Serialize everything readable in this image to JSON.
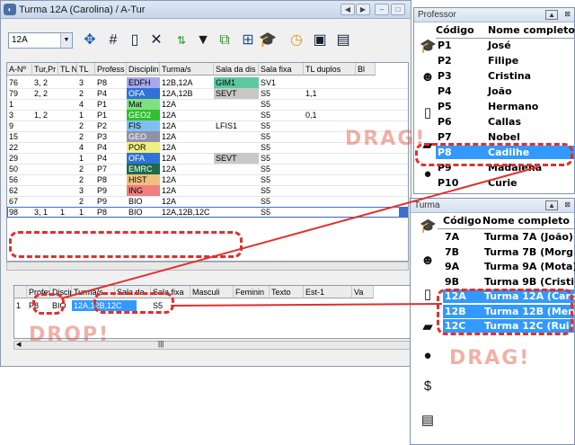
{
  "window": {
    "title": "Turma 12A (Carolina) / A-Tur"
  },
  "toolbar": {
    "class_select": "12A"
  },
  "table": {
    "headers": [
      "A-Nº",
      "Tur,Pr",
      "TL Ni",
      "TL",
      "Profess",
      "Disciplina",
      "Turma/s",
      "Sala da dis",
      "Sala fixa",
      "TL duplos",
      "Bl"
    ],
    "rows": [
      {
        "n": "76",
        "tp": "3, 2",
        "tln": "",
        "tl": "3",
        "prof": "P8",
        "disc": "EDFH",
        "disc_color": "#a8a8f0",
        "turmas": "12B,12A",
        "sala": "GIM1",
        "sala_color": "#5ec8a0",
        "fixa": "SV1",
        "dup": ""
      },
      {
        "n": "79",
        "tp": "2, 2",
        "tln": "",
        "tl": "2",
        "prof": "P4",
        "disc": "OFA",
        "disc_color": "#2f72d8",
        "turmas": "12A,12B",
        "sala": "SEVT",
        "sala_color": "#c8c8c8",
        "fixa": "S5",
        "dup": "1,1"
      },
      {
        "n": "1",
        "tp": "",
        "tln": "",
        "tl": "4",
        "prof": "P1",
        "disc": "Mat",
        "disc_color": "#80e080",
        "turmas": "12A",
        "sala": "",
        "sala_color": "",
        "fixa": "S5",
        "dup": ""
      },
      {
        "n": "3",
        "tp": "1, 2",
        "tln": "",
        "tl": "1",
        "prof": "P1",
        "disc": "GEO2",
        "disc_color": "#30c030",
        "turmas": "12A",
        "sala": "",
        "sala_color": "",
        "fixa": "S5",
        "dup": "0,1"
      },
      {
        "n": "9",
        "tp": "",
        "tln": "",
        "tl": "2",
        "prof": "P2",
        "disc": "FIS",
        "disc_color": "#80c0f0",
        "turmas": "12A",
        "sala": "LFIS1",
        "sala_color": "",
        "fixa": "S5",
        "dup": ""
      },
      {
        "n": "15",
        "tp": "",
        "tln": "",
        "tl": "2",
        "prof": "P3",
        "disc": "GEO",
        "disc_color": "#9090a8",
        "turmas": "12A",
        "sala": "",
        "sala_color": "",
        "fixa": "S5",
        "dup": ""
      },
      {
        "n": "22",
        "tp": "",
        "tln": "",
        "tl": "4",
        "prof": "P4",
        "disc": "POR",
        "disc_color": "#f0f080",
        "turmas": "12A",
        "sala": "",
        "sala_color": "",
        "fixa": "S5",
        "dup": ""
      },
      {
        "n": "29",
        "tp": "",
        "tln": "",
        "tl": "1",
        "prof": "P4",
        "disc": "OFA",
        "disc_color": "#2f72d8",
        "turmas": "12A",
        "sala": "SEVT",
        "sala_color": "#c8c8c8",
        "fixa": "S5",
        "dup": ""
      },
      {
        "n": "50",
        "tp": "",
        "tln": "",
        "tl": "2",
        "prof": "P7",
        "disc": "EMRC",
        "disc_color": "#1e6a4a",
        "turmas": "12A",
        "sala": "",
        "sala_color": "",
        "fixa": "S5",
        "dup": ""
      },
      {
        "n": "56",
        "tp": "",
        "tln": "",
        "tl": "2",
        "prof": "P8",
        "disc": "HIST",
        "disc_color": "#f0c080",
        "turmas": "12A",
        "sala": "",
        "sala_color": "",
        "fixa": "S5",
        "dup": ""
      },
      {
        "n": "62",
        "tp": "",
        "tln": "",
        "tl": "3",
        "prof": "P9",
        "disc": "ING",
        "disc_color": "#f08080",
        "turmas": "12A",
        "sala": "",
        "sala_color": "",
        "fixa": "S5",
        "dup": ""
      },
      {
        "n": "67",
        "tp": "",
        "tln": "",
        "tl": "2",
        "prof": "P9",
        "disc": "BIO",
        "disc_color": "",
        "turmas": "12A",
        "sala": "",
        "sala_color": "",
        "fixa": "S5",
        "dup": ""
      },
      {
        "n": "98",
        "tp": "3, 1",
        "tln": "1",
        "tl": "1",
        "prof": "P8",
        "disc": "BIO",
        "disc_color": "",
        "turmas": "12A,12B,12C",
        "sala": "",
        "sala_color": "",
        "fixa": "S5",
        "dup": ""
      }
    ]
  },
  "detail": {
    "headers": [
      "",
      "Profess",
      "Discip",
      "Turma/s",
      "Sala da",
      "Sala fixa",
      "Masculi",
      "Feminin",
      "Texto",
      "Est-1",
      "Va"
    ],
    "row": {
      "n": "1",
      "prof": "P8",
      "disc": "BIO",
      "turmas": "12A,12B,12C",
      "fixa": "S5"
    }
  },
  "professor_panel": {
    "title": "Professor",
    "col_code": "Código",
    "col_name": "Nome completo",
    "items": [
      {
        "code": "P1",
        "name": "José"
      },
      {
        "code": "P2",
        "name": "Filipe"
      },
      {
        "code": "P3",
        "name": "Cristina"
      },
      {
        "code": "P4",
        "name": "João"
      },
      {
        "code": "P5",
        "name": "Hermano"
      },
      {
        "code": "P6",
        "name": "Callas"
      },
      {
        "code": "P7",
        "name": "Nobel"
      },
      {
        "code": "P8",
        "name": "Cadilhe"
      },
      {
        "code": "P9",
        "name": "Madalena"
      },
      {
        "code": "P10",
        "name": "Curie"
      }
    ]
  },
  "turma_panel": {
    "title": "Turma",
    "col_code": "Código",
    "col_name": "Nome completo",
    "items": [
      {
        "code": "7A",
        "name": "Turma 7A (João)"
      },
      {
        "code": "7B",
        "name": "Turma 7B (Morg"
      },
      {
        "code": "9A",
        "name": "Turma 9A (Mota)"
      },
      {
        "code": "9B",
        "name": "Turma 9B (Cristi"
      },
      {
        "code": "12A",
        "name": "Turma 12A (Caro"
      },
      {
        "code": "12B",
        "name": "Turma 12B (Men"
      },
      {
        "code": "12C",
        "name": "Turma 12C (Rui)"
      }
    ]
  },
  "annotations": {
    "drag1": "DRAG!",
    "drag2": "DRAG!",
    "drop": "DROP!"
  },
  "colors": {
    "accent": "#e0302c",
    "selection": "#3399ff"
  }
}
